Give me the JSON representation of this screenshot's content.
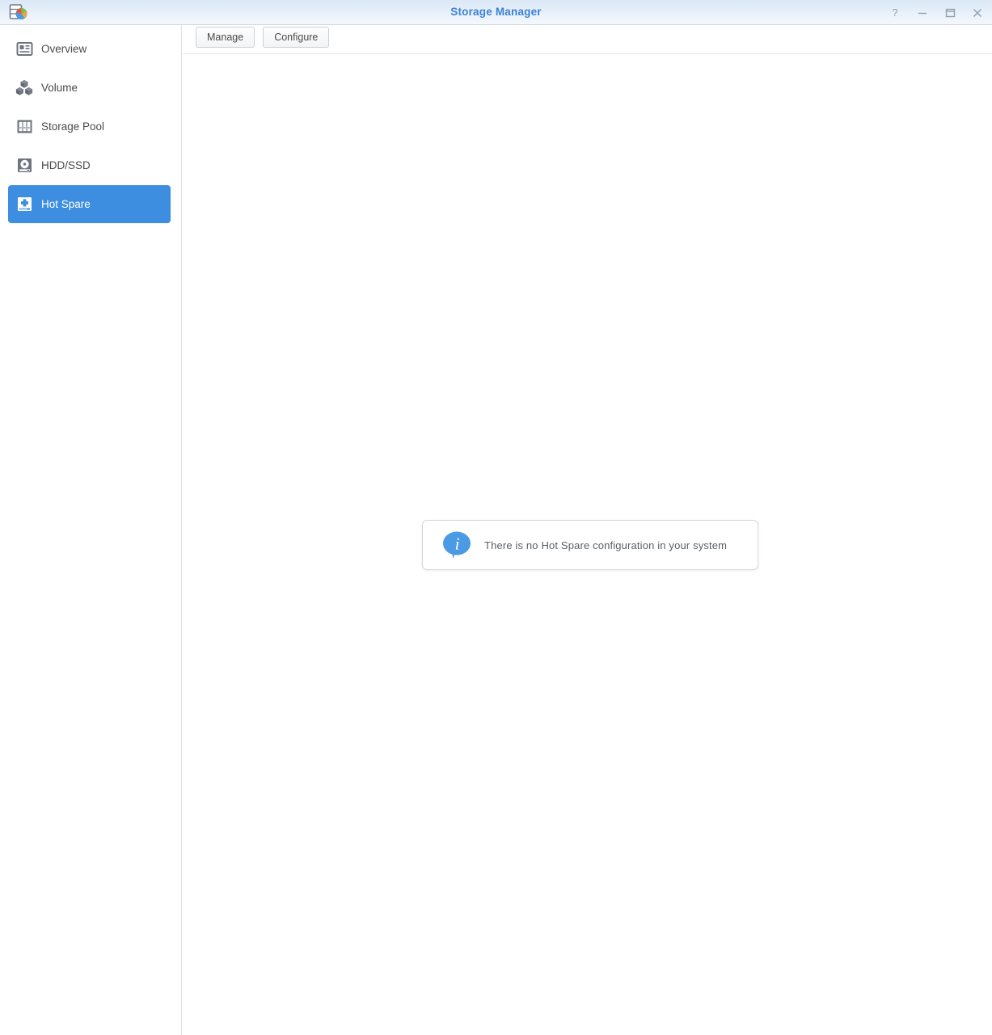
{
  "window": {
    "title": "Storage Manager",
    "logo_icon": "storage-manager-logo-icon",
    "controls": [
      {
        "name": "help-button",
        "icon": "question-mark-icon",
        "label": "?"
      },
      {
        "name": "minimize-button",
        "icon": "minimize-icon",
        "label": "—"
      },
      {
        "name": "maximize-button",
        "icon": "maximize-icon",
        "label": "❑"
      },
      {
        "name": "close-button",
        "icon": "close-icon",
        "label": "✕"
      }
    ]
  },
  "sidebar": {
    "items": [
      {
        "label": "Overview",
        "icon": "overview-icon",
        "active": false
      },
      {
        "label": "Volume",
        "icon": "volume-cubes-icon",
        "active": false
      },
      {
        "label": "Storage Pool",
        "icon": "storage-pool-icon",
        "active": false
      },
      {
        "label": "HDD/SSD",
        "icon": "hdd-ssd-icon",
        "active": false
      },
      {
        "label": "Hot Spare",
        "icon": "hot-spare-icon",
        "active": true
      }
    ]
  },
  "toolbar": {
    "manage_label": "Manage",
    "configure_label": "Configure"
  },
  "main": {
    "empty_state": {
      "icon": "info-bubble-icon",
      "message": "There is no Hot Spare configuration in your system"
    }
  },
  "colors": {
    "accent_blue": "#3d8ee0",
    "title_text": "#3b82d6",
    "titlebar_top": "#dbe8f6",
    "titlebar_bottom": "#f4f8fc",
    "nav_text": "#4a4a4a",
    "icon_gray": "#6d7480",
    "message_text": "#5a6069"
  }
}
